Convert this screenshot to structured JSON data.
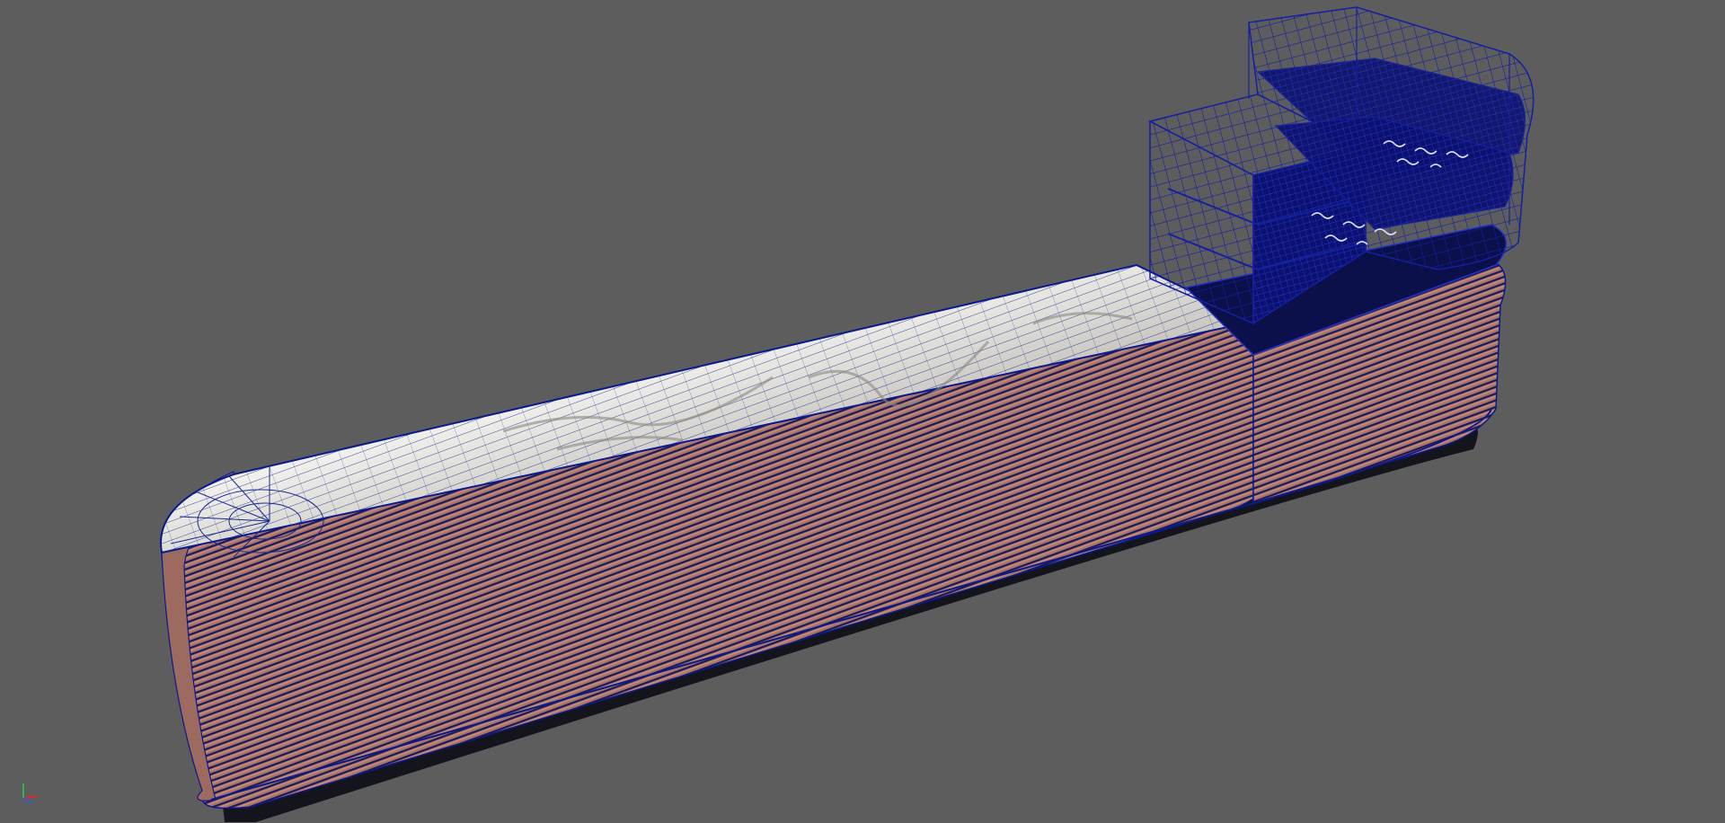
{
  "viewport": {
    "background": "#5d5d5d",
    "camera": "perspective",
    "display_mode": "wireframe-on-shaded"
  },
  "scene": {
    "object": "reception-counter",
    "materials": {
      "countertop": "white-marble",
      "side_panels": "wood-slats",
      "wireframe": "#0a1a8c"
    },
    "selected_parts": [
      "shelving-unit",
      "tiered-display"
    ]
  },
  "axis_gizmo": {
    "icon": "xyz-axis-icon",
    "colors": {
      "x": "#d23030",
      "y": "#2fb84a",
      "z": "#3a5ad8"
    }
  }
}
